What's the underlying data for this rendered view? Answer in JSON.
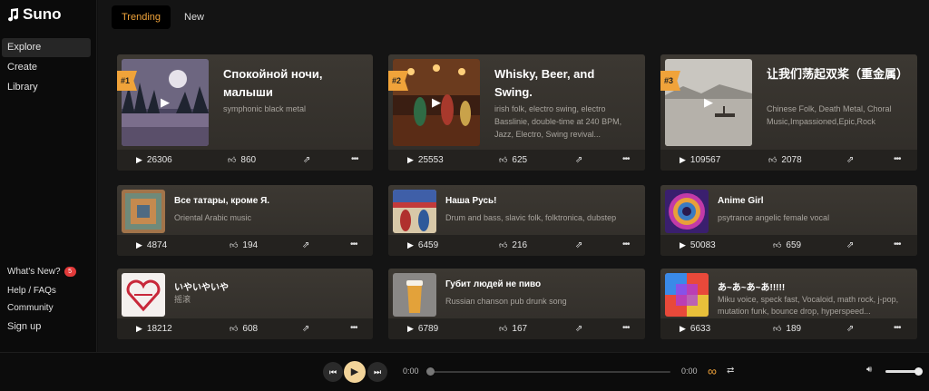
{
  "app": {
    "logo_text": "Suno"
  },
  "sidebar": {
    "items": [
      {
        "label": "Explore",
        "active": true
      },
      {
        "label": "Create"
      },
      {
        "label": "Library"
      }
    ],
    "bottom": {
      "whats_new": "What's New?",
      "whats_new_badge": "5",
      "help": "Help / FAQs",
      "community": "Community",
      "signup": "Sign up"
    }
  },
  "tabs": [
    {
      "label": "Trending",
      "active": true
    },
    {
      "label": "New"
    }
  ],
  "featured": [
    {
      "rank": "#1",
      "title": "Спокойной ночи, малыши",
      "tags": "symphonic black metal",
      "plays": "26306",
      "likes": "860"
    },
    {
      "rank": "#2",
      "title": "Whisky, Beer, and Swing.",
      "tags": "irish folk, electro swing, electro Basslinie, double-time at 240 BPM, Jazz, Electro, Swing revival...",
      "plays": "25553",
      "likes": "625"
    },
    {
      "rank": "#3",
      "title": "让我们荡起双桨（重金属）",
      "tags": "Chinese Folk, Death Metal, Choral Music,Impassioned,Epic,Rock",
      "plays": "109567",
      "likes": "2078"
    }
  ],
  "songs": [
    {
      "title": "Все татары, кроме Я.",
      "tags": "Oriental Arabic music",
      "plays": "4874",
      "likes": "194"
    },
    {
      "title": "Наша Русь!",
      "tags": "Drum and bass, slavic folk, folktronica, dubstep",
      "plays": "6459",
      "likes": "216"
    },
    {
      "title": "Anime Girl",
      "tags": "psytrance angelic female vocal",
      "plays": "50083",
      "likes": "659"
    },
    {
      "title": "いやいやいや",
      "tags": "摇滚",
      "plays": "18212",
      "likes": "608"
    },
    {
      "title": "Губит людей не пиво",
      "tags": "Russian chanson pub drunk song",
      "plays": "6789",
      "likes": "167"
    },
    {
      "title": "あ~あ~あ~あ!!!!!",
      "tags": "Miku voice, speck fast, Vocaloid, math rock, j-pop, mutation funk, bounce drop, hyperspeed...",
      "plays": "6633",
      "likes": "189"
    }
  ],
  "player": {
    "current_time": "0:00",
    "duration": "0:00",
    "progress": 0,
    "volume": 0.9
  },
  "icons": {
    "play": "play-icon",
    "like": "thumbs-up-icon",
    "share": "share-icon",
    "more": "more-icon",
    "prev": "skip-previous-icon",
    "next": "skip-next-icon",
    "loop": "infinity-loop-icon",
    "repeat": "repeat-icon",
    "volume": "volume-icon"
  },
  "colors": {
    "accent": "#f0a33a",
    "background": "#141414",
    "card": "#38342f"
  }
}
